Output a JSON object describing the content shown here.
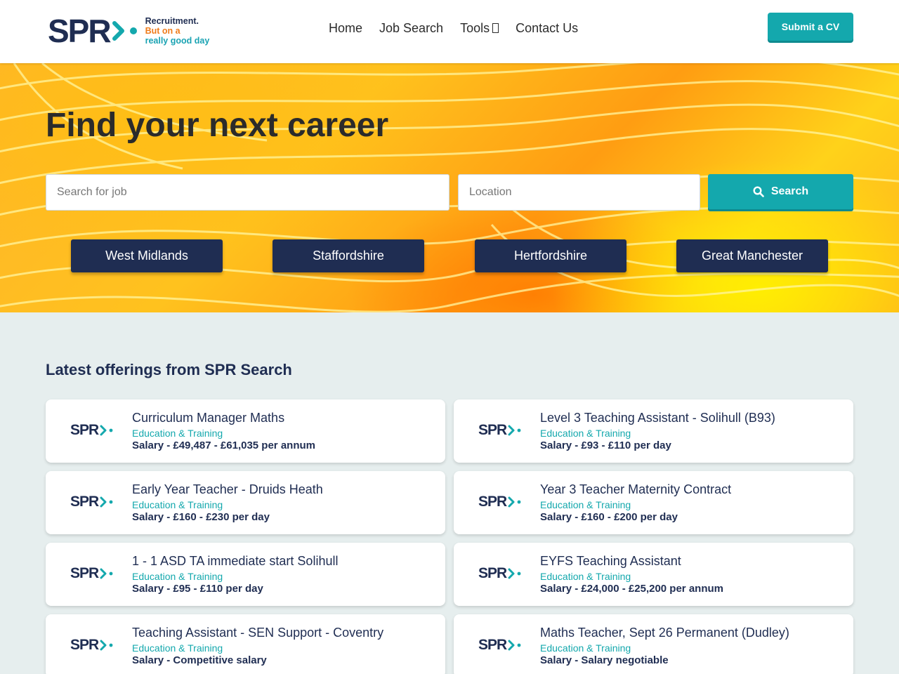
{
  "header": {
    "logo": {
      "text": "SPR",
      "tagline_1": "Recruitment.",
      "tagline_2": "But on a",
      "tagline_3": "really good day"
    },
    "nav": [
      {
        "label": "Home"
      },
      {
        "label": "Job Search"
      },
      {
        "label": "Tools",
        "has_dropdown": true,
        "caret_icon": "chevron-down-icon"
      },
      {
        "label": "Contact Us"
      }
    ],
    "submit_cv_label": "Submit a CV"
  },
  "hero": {
    "title": "Find your next career",
    "search": {
      "job_placeholder": "Search for job",
      "job_value": "",
      "location_placeholder": "Location",
      "location_value": "",
      "button_label": "Search",
      "button_icon": "search-icon"
    },
    "regions": [
      "West Midlands",
      "Staffordshire",
      "Hertfordshire",
      "Great Manchester"
    ]
  },
  "listings": {
    "heading": "Latest offerings from SPR Search",
    "jobs": [
      {
        "title": "Curriculum Manager Maths",
        "category": "Education & Training",
        "salary": "Salary - £49,487 - £61,035 per annum"
      },
      {
        "title": "Level 3 Teaching Assistant - Solihull (B93)",
        "category": "Education & Training",
        "salary": "Salary - £93 - £110 per day"
      },
      {
        "title": "Early Year Teacher - Druids Heath",
        "category": "Education & Training",
        "salary": "Salary - £160 - £230 per day"
      },
      {
        "title": "Year 3 Teacher Maternity Contract",
        "category": "Education & Training",
        "salary": "Salary - £160 - £200 per day"
      },
      {
        "title": "1 - 1 ASD TA immediate start Solihull",
        "category": "Education & Training",
        "salary": "Salary - £95 - £110 per day"
      },
      {
        "title": "EYFS Teaching Assistant",
        "category": "Education & Training",
        "salary": "Salary - £24,000 - £25,200 per annum"
      },
      {
        "title": "Teaching Assistant - SEN Support - Coventry",
        "category": "Education & Training",
        "salary": "Salary - Competitive salary"
      },
      {
        "title": "Maths Teacher, Sept 26 Permanent (Dudley)",
        "category": "Education & Training",
        "salary": "Salary - Salary negotiable"
      }
    ]
  },
  "colors": {
    "brand_navy": "#1f2d52",
    "brand_teal": "#14a8ad",
    "brand_orange": "#f07b1a",
    "page_bg": "#e6eeee"
  }
}
